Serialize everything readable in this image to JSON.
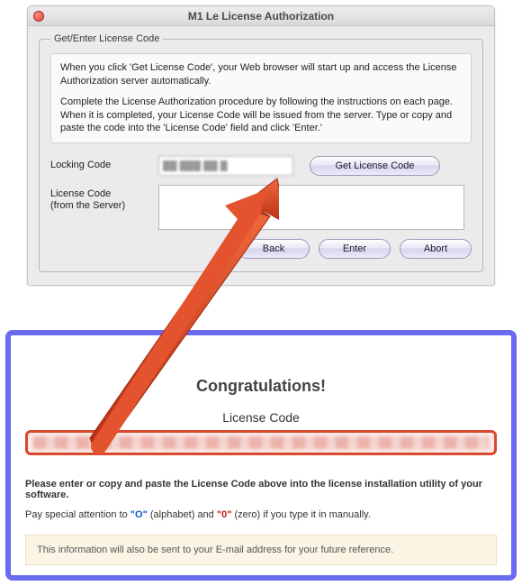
{
  "dialog": {
    "title": "M1 Le License Authorization",
    "group_legend": "Get/Enter License Code",
    "instructions_p1": "When you click 'Get License Code', your Web browser will start up and access the License Authorization server automatically.",
    "instructions_p2": "Complete the License Authorization procedure by following the instructions on each page.  When it is completed, your License Code will be issued from the server.  Type or copy and paste the code into the 'License Code' field and click 'Enter.'",
    "locking_label": "Locking Code",
    "locking_value": "██ ███ ██ █",
    "license_label": "License Code\n(from the Server)",
    "license_value": "",
    "get_license_btn": "Get License Code",
    "back_btn": "Back",
    "enter_btn": "Enter",
    "abort_btn": "Abort"
  },
  "congrats": {
    "title": "Congratulations!",
    "lic_heading": "License Code",
    "instruction": "Please enter or copy and paste the License Code above into the license installation utility of your software.",
    "attention_pre": "Pay special attention to ",
    "o_alpha": "\"O\"",
    "alpha_note": " (alphabet) and ",
    "o_zero": "\"0\"",
    "zero_note": " (zero) if you type it in manually.",
    "email_note": "This information will also be sent to your E-mail address for your future reference."
  }
}
